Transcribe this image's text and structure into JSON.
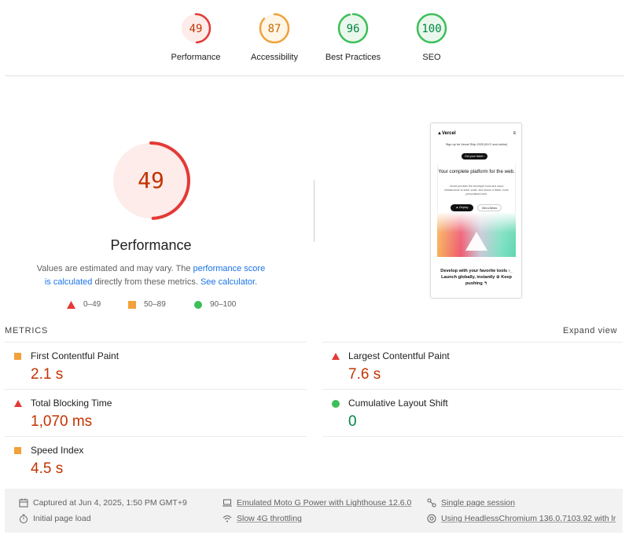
{
  "gauges": [
    {
      "score": "49",
      "label": "Performance",
      "value": 0.49,
      "color": "#e53935",
      "bg": "#fdecea",
      "text_color": "#c33300"
    },
    {
      "score": "87",
      "label": "Accessibility",
      "value": 0.87,
      "color": "#f2a13b",
      "bg": "#fff6e8",
      "text_color": "#c76b00"
    },
    {
      "score": "96",
      "label": "Best Practices",
      "value": 0.96,
      "color": "#3bbf58",
      "bg": "#eaf7ed",
      "text_color": "#018642"
    },
    {
      "score": "100",
      "label": "SEO",
      "value": 1.0,
      "color": "#3bbf58",
      "bg": "#eaf7ed",
      "text_color": "#018642"
    }
  ],
  "performance": {
    "score": "49",
    "value": 0.49,
    "title": "Performance",
    "desc_prefix": "Values are estimated and may vary. The ",
    "desc_link1": "performance score is calculated",
    "desc_mid": " directly from these metrics. ",
    "desc_link2": "See calculator",
    "desc_suffix": ".",
    "legend": [
      {
        "shape": "triangle",
        "range": "0–49",
        "color": "#e53935"
      },
      {
        "shape": "square",
        "range": "50–89",
        "color": "#f2a13b"
      },
      {
        "shape": "circle",
        "range": "90–100",
        "color": "#3bbf58"
      }
    ]
  },
  "screenshot": {
    "brand": "▲Vercel",
    "menu": "≡",
    "announce": "Sign up for Vercel Ship 2025 (NYC and online)",
    "ticket": "Get your ticket ›",
    "hero": "Your complete platform for the web.",
    "sub": "Vercel provides the developer tools and cloud infrastructure to build, scale, and secure a faster, more personalized web.",
    "btn_deploy": "▲ Deploy",
    "btn_demo": "Get a Demo",
    "footer_text": "Develop with your favorite tools ›_ Launch globally, instantly ⊕ Keep pushing ↰"
  },
  "metrics": {
    "heading": "METRICS",
    "expand": "Expand view",
    "items": [
      {
        "name": "First Contentful Paint",
        "value": "2.1 s",
        "rating": "average"
      },
      {
        "name": "Largest Contentful Paint",
        "value": "7.6 s",
        "rating": "fail"
      },
      {
        "name": "Total Blocking Time",
        "value": "1,070 ms",
        "rating": "fail"
      },
      {
        "name": "Cumulative Layout Shift",
        "value": "0",
        "rating": "pass"
      },
      {
        "name": "Speed Index",
        "value": "4.5 s",
        "rating": "average"
      }
    ]
  },
  "footer": {
    "captured": "Captured at Jun 4, 2025, 1:50 PM GMT+9",
    "initial_load": "Initial page load",
    "device": "Emulated Moto G Power with Lighthouse 12.6.0",
    "throttling": "Slow 4G throttling",
    "session": "Single page session",
    "browser": "Using HeadlessChromium 136.0.7103.92 with lr"
  }
}
